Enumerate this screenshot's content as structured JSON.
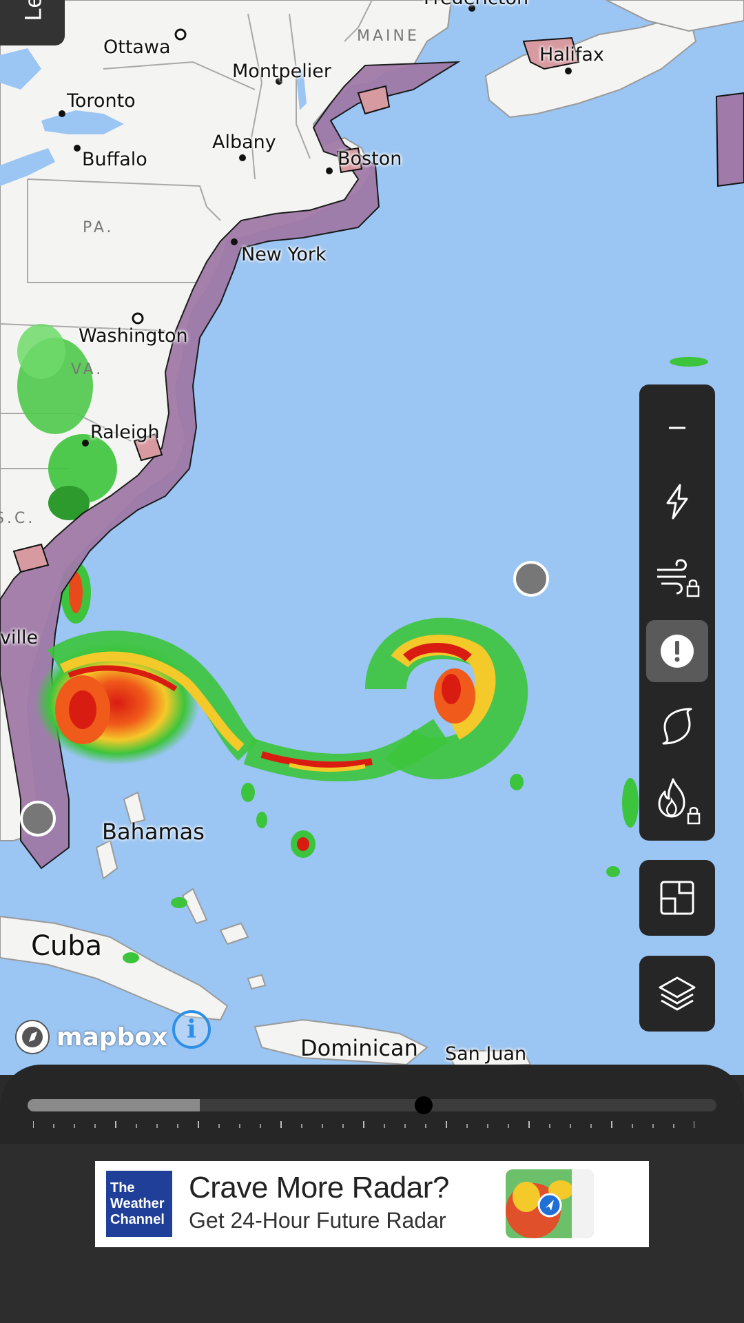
{
  "top_tab": {
    "label": "Le"
  },
  "map": {
    "cities": [
      {
        "name": "Ottawa"
      },
      {
        "name": "Montpelier"
      },
      {
        "name": "Toronto"
      },
      {
        "name": "Albany"
      },
      {
        "name": "Buffalo"
      },
      {
        "name": "Boston"
      },
      {
        "name": "New York"
      },
      {
        "name": "Washington"
      },
      {
        "name": "Raleigh"
      },
      {
        "name": "Halifax"
      },
      {
        "name": "ville"
      },
      {
        "name": "Fredericton"
      },
      {
        "name": "San Juan"
      }
    ],
    "regions": [
      {
        "name": "MAINE"
      },
      {
        "name": "PA."
      },
      {
        "name": "VA."
      },
      {
        "name": "S.C."
      }
    ],
    "countries": [
      {
        "name": "Bahamas"
      },
      {
        "name": "Cuba"
      },
      {
        "name": "Dominican"
      }
    ],
    "attribution": {
      "logo_text": "mapbox",
      "info_icon": "info-icon"
    }
  },
  "toolbar": {
    "items": [
      {
        "icon": "minus-icon",
        "locked": false,
        "active": false
      },
      {
        "icon": "lightning-icon",
        "locked": false,
        "active": false
      },
      {
        "icon": "wind-icon",
        "locked": true,
        "active": false
      },
      {
        "icon": "alert-icon",
        "locked": false,
        "active": true
      },
      {
        "icon": "hurricane-icon",
        "locked": false,
        "active": false
      },
      {
        "icon": "fire-icon",
        "locked": true,
        "active": false
      }
    ],
    "extra_buttons": [
      {
        "icon": "frame-icon"
      },
      {
        "icon": "layers-icon"
      }
    ]
  },
  "timeline": {
    "past_fill_fraction": 0.25,
    "scrubber_fraction": 0.575
  },
  "ad": {
    "brand_lines": [
      "The",
      "Weather",
      "Channel"
    ],
    "headline": "Crave More Radar?",
    "subline": "Get 24-Hour Future Radar"
  },
  "colors": {
    "ocean": "#9bc5f2",
    "land": "#f4f4f2",
    "warning": "#a07aa8",
    "advisory": "#d79aa0",
    "panel": "#262626",
    "info_blue": "#2f8fe6"
  }
}
